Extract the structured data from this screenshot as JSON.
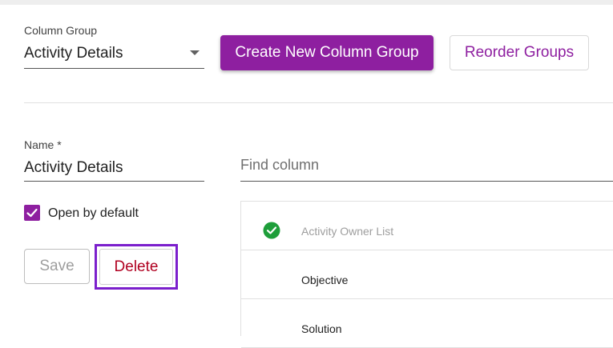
{
  "column_group": {
    "label": "Column Group",
    "selected_value": "Activity Details",
    "create_button_label": "Create New Column Group",
    "reorder_button_label": "Reorder Groups"
  },
  "form": {
    "name_label": "Name *",
    "name_value": "Activity Details",
    "open_by_default_label": "Open by default",
    "open_by_default_checked": true,
    "save_label": "Save",
    "delete_label": "Delete"
  },
  "columns": {
    "find_placeholder": "Find column",
    "items": [
      {
        "label": "Activity Owner List",
        "icon": "check-circle-icon"
      },
      {
        "label": "Objective"
      },
      {
        "label": "Solution"
      }
    ]
  },
  "colors": {
    "primary": "#8e1fa0",
    "delete_text": "#b00020",
    "highlight_border": "#7b1fcc",
    "check_green": "#1e9e3a"
  }
}
